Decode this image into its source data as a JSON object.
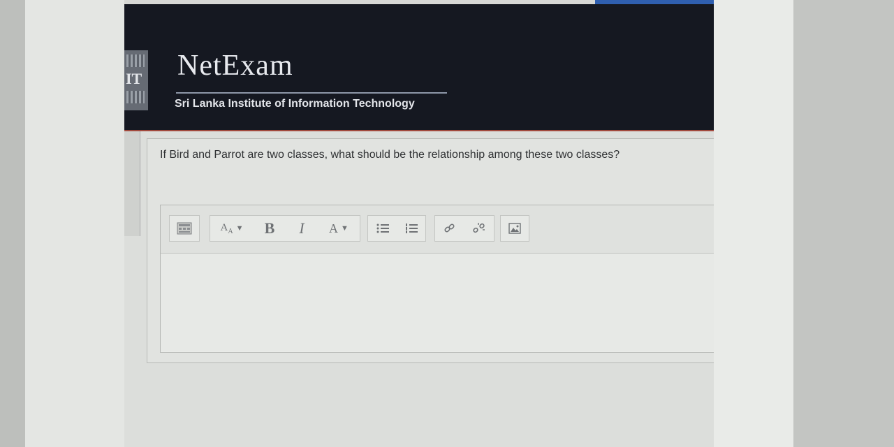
{
  "header": {
    "brand_title": "NetExam",
    "brand_subtitle": "Sri Lanka Institute of Information Technology",
    "logo_letters": "IT"
  },
  "question": {
    "text": "If Bird and Parrot are two classes, what should be the relationship among these two classes?"
  },
  "toolbar": {
    "font_size_label": "A",
    "bold_label": "B",
    "italic_label": "I",
    "font_color_label": "A",
    "icons": [
      "toolbar-toggle-icon",
      "font-size-icon",
      "bold-icon",
      "italic-icon",
      "font-color-icon",
      "bullet-list-icon",
      "numbered-list-icon",
      "link-icon",
      "unlink-icon",
      "image-icon"
    ]
  },
  "colors": {
    "header_bg": "#151821",
    "header_accent": "#a24a3e",
    "top_accent": "#2f5fb0"
  }
}
